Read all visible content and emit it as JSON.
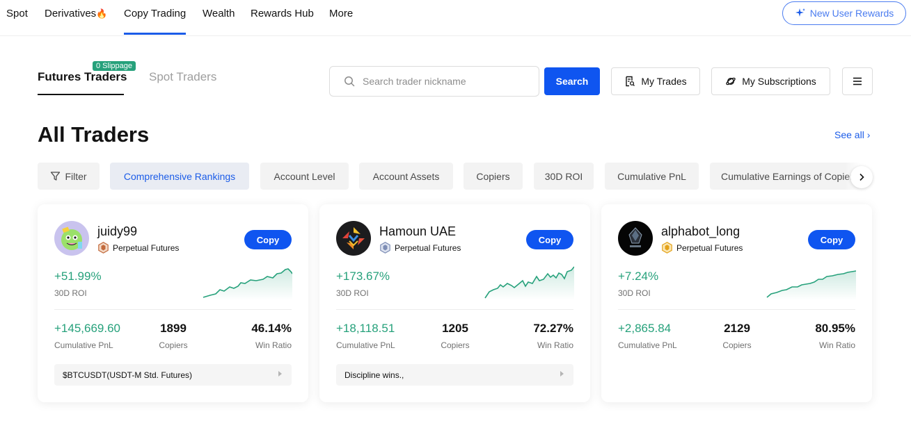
{
  "nav": {
    "items": [
      {
        "label": "Spot"
      },
      {
        "label": "Derivatives"
      },
      {
        "label": "Copy Trading"
      },
      {
        "label": "Wealth"
      },
      {
        "label": "Rewards Hub"
      },
      {
        "label": "More"
      }
    ],
    "fire_icon": "fire-icon",
    "rewards_label": "New User Rewards",
    "accent": "#1b5ce8"
  },
  "tabs": {
    "futures": "Futures Traders",
    "spot": "Spot Traders",
    "slippage_badge": "0 Slippage"
  },
  "search": {
    "placeholder": "Search trader nickname",
    "value": "",
    "button": "Search"
  },
  "actions": {
    "my_trades": "My Trades",
    "my_subscriptions": "My Subscriptions"
  },
  "section": {
    "title": "All Traders",
    "see_all": "See all"
  },
  "filters": {
    "filter_label": "Filter",
    "chips": [
      "Comprehensive Rankings",
      "Account Level",
      "Account Assets",
      "Copiers",
      "30D ROI",
      "Cumulative PnL",
      "Cumulative Earnings of Copiers"
    ],
    "active": "Comprehensive Rankings"
  },
  "traders": [
    {
      "name": "juidy99",
      "market": "Perpetual Futures",
      "badge_color": "#c26a3d",
      "copy_label": "Copy",
      "roi": "+51.99%",
      "roi_label": "30D ROI",
      "pnl": "+145,669.60",
      "pnl_label": "Cumulative PnL",
      "copiers": "1899",
      "copiers_label": "Copiers",
      "win_ratio": "46.14%",
      "win_ratio_label": "Win Ratio",
      "description": "$BTCUSDT(USDT-M Std. Futures)"
    },
    {
      "name": "Hamoun UAE",
      "market": "Perpetual Futures",
      "badge_color": "#7d8db5",
      "copy_label": "Copy",
      "roi": "+173.67%",
      "roi_label": "30D ROI",
      "pnl": "+18,118.51",
      "pnl_label": "Cumulative PnL",
      "copiers": "1205",
      "copiers_label": "Copiers",
      "win_ratio": "72.27%",
      "win_ratio_label": "Win Ratio",
      "description": "Discipline wins.,"
    },
    {
      "name": "alphabot_long",
      "market": "Perpetual Futures",
      "badge_color": "#e3a21a",
      "copy_label": "Copy",
      "roi": "+7.24%",
      "roi_label": "30D ROI",
      "pnl": "+2,865.84",
      "pnl_label": "Cumulative PnL",
      "copiers": "2129",
      "copiers_label": "Copiers",
      "win_ratio": "80.95%",
      "win_ratio_label": "Win Ratio",
      "description": ""
    }
  ],
  "colors": {
    "positive": "#26a17b",
    "primary_button": "#0f55f0"
  }
}
